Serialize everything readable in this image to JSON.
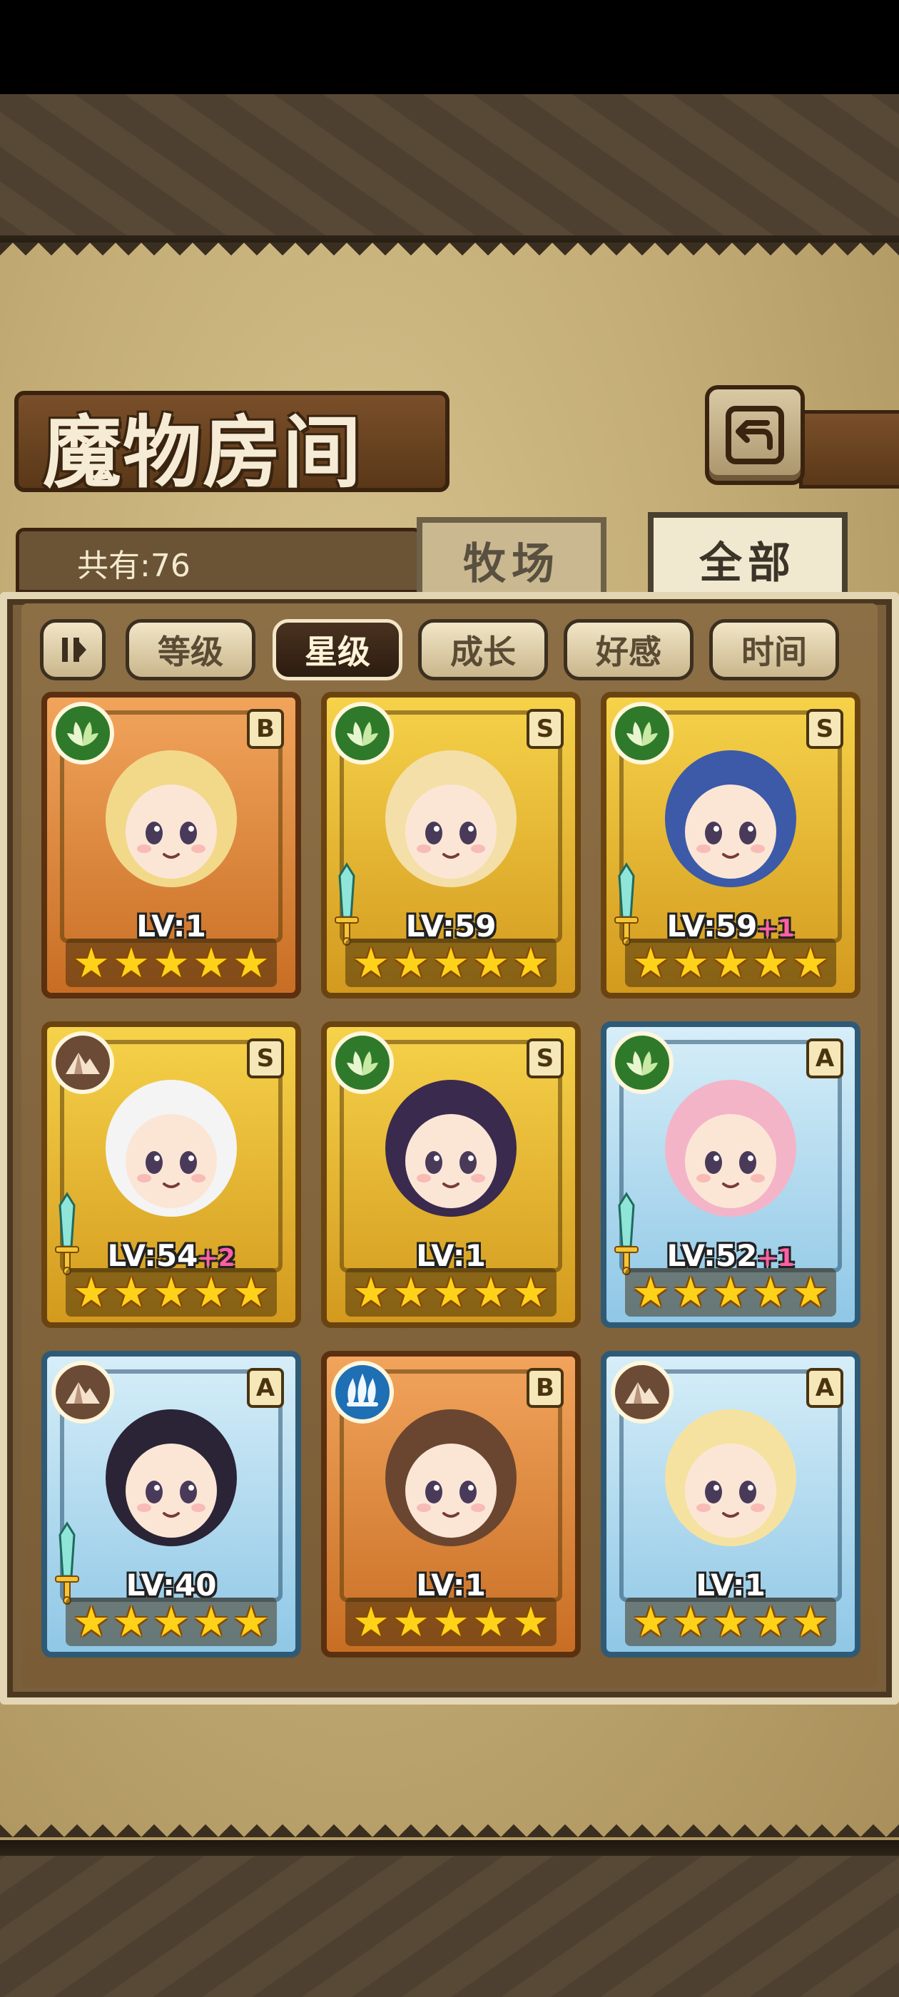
{
  "title": "魔物房间",
  "count_label": "共有:76",
  "tabs": [
    {
      "label": "牧场",
      "active": false
    },
    {
      "label": "全部",
      "active": true
    }
  ],
  "sort_buttons": [
    {
      "label": "等级",
      "active": false
    },
    {
      "label": "星级",
      "active": true
    },
    {
      "label": "成长",
      "active": false
    },
    {
      "label": "好感",
      "active": false
    },
    {
      "label": "时间",
      "active": false
    }
  ],
  "cards": [
    {
      "element": "leaf",
      "rank": "B",
      "level": "LV:1",
      "bonus": "",
      "stars": 5,
      "frame": "bronze",
      "equipped": false,
      "hair": "#f2d98a"
    },
    {
      "element": "leaf",
      "rank": "S",
      "level": "LV:59",
      "bonus": "",
      "stars": 5,
      "frame": "gold",
      "equipped": true,
      "hair": "#f4dfa8"
    },
    {
      "element": "leaf",
      "rank": "S",
      "level": "LV:59",
      "bonus": "+1",
      "stars": 5,
      "frame": "gold",
      "equipped": true,
      "hair": "#3c5aa8"
    },
    {
      "element": "earth",
      "rank": "S",
      "level": "LV:54",
      "bonus": "+2",
      "stars": 5,
      "frame": "gold",
      "equipped": true,
      "hair": "#f4f4f4"
    },
    {
      "element": "leaf",
      "rank": "S",
      "level": "LV:1",
      "bonus": "",
      "stars": 5,
      "frame": "gold",
      "equipped": false,
      "hair": "#3a2a4e"
    },
    {
      "element": "leaf",
      "rank": "A",
      "level": "LV:52",
      "bonus": "+1",
      "stars": 5,
      "frame": "blue",
      "equipped": true,
      "hair": "#f4b4c8"
    },
    {
      "element": "earth",
      "rank": "A",
      "level": "LV:40",
      "bonus": "",
      "stars": 5,
      "frame": "blue",
      "equipped": true,
      "hair": "#2a2436"
    },
    {
      "element": "water",
      "rank": "B",
      "level": "LV:1",
      "bonus": "",
      "stars": 5,
      "frame": "bronze",
      "equipped": false,
      "hair": "#6a4630"
    },
    {
      "element": "earth",
      "rank": "A",
      "level": "LV:1",
      "bonus": "",
      "stars": 5,
      "frame": "blue",
      "equipped": false,
      "hair": "#f6e2a0"
    }
  ]
}
